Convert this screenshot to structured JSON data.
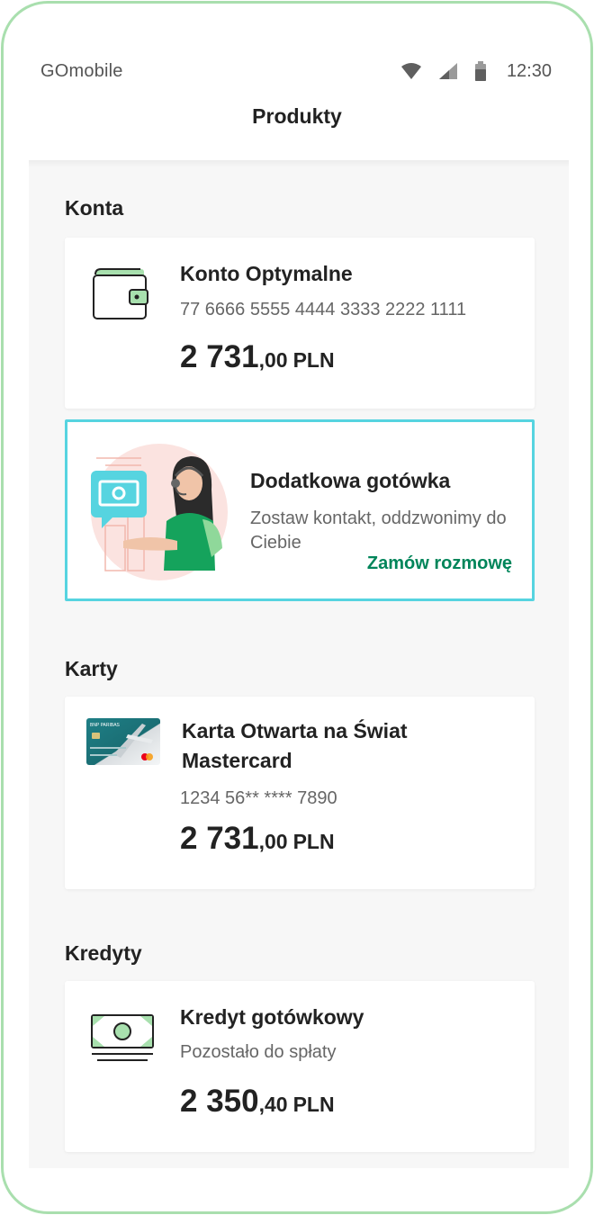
{
  "status_bar": {
    "carrier": "GOmobile",
    "time": "12:30",
    "icons": [
      "wifi-icon",
      "signal-icon",
      "battery-icon"
    ]
  },
  "header": {
    "title": "Produkty"
  },
  "sections": {
    "accounts": {
      "title": "Konta",
      "items": [
        {
          "icon": "wallet-icon",
          "name": "Konto Optymalne",
          "number": "77 6666 5555 4444 3333 2222 1111",
          "amount_int": "2 731",
          "amount_dec": ",00",
          "currency": "PLN"
        }
      ],
      "promo": {
        "illustration": "call-center-agent-illustration",
        "title": "Dodatkowa gotówka",
        "description": "Zostaw kontakt, oddzwonimy do Ciebie",
        "cta": "Zamów rozmowę"
      }
    },
    "cards": {
      "title": "Karty",
      "items": [
        {
          "icon": "credit-card-image",
          "name": "Karta Otwarta na Świat Mastercard",
          "number": "1234 56** **** 7890",
          "amount_int": "2 731",
          "amount_dec": ",00",
          "currency": "PLN",
          "card_brand_text": "BNP PARIBAS"
        }
      ]
    },
    "loans": {
      "title": "Kredyty",
      "items": [
        {
          "icon": "banknote-icon",
          "name": "Kredyt gotówkowy",
          "label": "Pozostało do spłaty",
          "amount_int": "2 350",
          "amount_dec": ",40",
          "currency": "PLN"
        }
      ]
    }
  },
  "colors": {
    "frame": "#a9dfae",
    "accent_green": "#00855a",
    "promo_border": "#56d4e0",
    "icon_green": "#a8e0ae",
    "background": "#f7f7f7"
  }
}
